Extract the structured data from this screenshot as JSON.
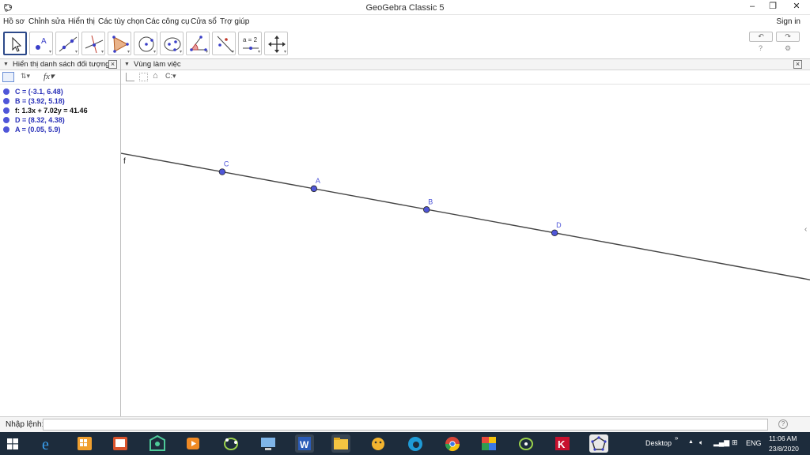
{
  "window": {
    "title": "GeoGebra Classic 5"
  },
  "menu": {
    "items": [
      "Hồ sơ",
      "Chỉnh sửa",
      "Hiển thị",
      "Các tùy chọn",
      "Các công cụ",
      "Cửa sổ",
      "Trợ giúp"
    ],
    "signin": "Sign in"
  },
  "toolbar": {
    "tools": [
      "move-tool",
      "point-tool",
      "line-tool",
      "perpendicular-tool",
      "polygon-tool",
      "circle-tool",
      "conic-tool",
      "angle-tool",
      "reflect-tool",
      "slider-tool",
      "move-view-tool"
    ],
    "slider_label": "a = 2"
  },
  "algebra": {
    "title": "Hiển thị danh sách đối tượng",
    "rows": [
      {
        "text": "C = (-3.1, 6.48)",
        "color": "#2a31b8"
      },
      {
        "text": "B = (3.92, 5.18)",
        "color": "#2a31b8"
      },
      {
        "text": "f: 1.3x + 7.02y = 41.46",
        "color": "#111111"
      },
      {
        "text": "D = (8.32, 4.38)",
        "color": "#2a31b8"
      },
      {
        "text": "A = (0.05, 5.9)",
        "color": "#2a31b8"
      }
    ]
  },
  "graphics": {
    "title": "Vùng làm việc",
    "line_label": "f",
    "points": [
      {
        "label": "C",
        "x": -3.1,
        "y": 6.48
      },
      {
        "label": "A",
        "x": 0.05,
        "y": 5.9
      },
      {
        "label": "B",
        "x": 3.92,
        "y": 5.18
      },
      {
        "label": "D",
        "x": 8.32,
        "y": 4.38
      }
    ],
    "point_color": "#4f56d8",
    "line_color": "#444444"
  },
  "inputbar": {
    "label": "Nhập lệnh:",
    "value": ""
  },
  "taskbar": {
    "desktop_label": "Desktop",
    "language": "ENG",
    "time": "11:06 AM",
    "date": "23/8/2020"
  }
}
